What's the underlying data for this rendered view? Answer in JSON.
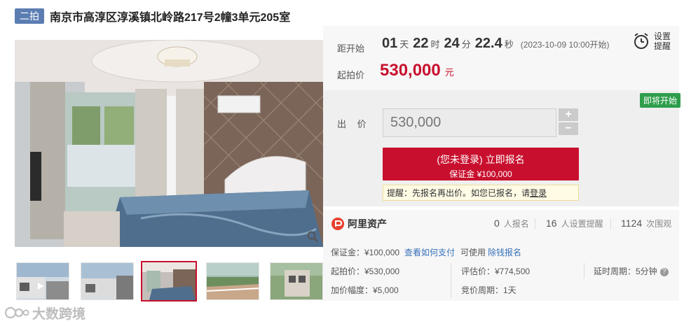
{
  "header": {
    "round_badge": "二拍",
    "title": "南京市高淳区淳溪镇北岭路217号2幢3单元205室"
  },
  "gallery": {
    "thumbnail_count": 5,
    "active_thumbnail": 3
  },
  "watermark": {
    "text": "大数跨境"
  },
  "countdown": {
    "label": "距开始",
    "days": "01",
    "days_unit": "天",
    "hours": "22",
    "hours_unit": "时",
    "minutes": "24",
    "minutes_unit": "分",
    "seconds": "22.4",
    "seconds_unit": "秒",
    "start_time": "(2023-10-09 10:00开始)"
  },
  "start_price": {
    "label": "起拍价",
    "value": "530,000",
    "unit": "元"
  },
  "reminder": {
    "label": "设置提醒",
    "icon": "alarm-clock-icon"
  },
  "bid": {
    "status_tag": "即将开始",
    "label": "出 价",
    "value": "530,000",
    "plus": "+",
    "minus": "−",
    "register_line1": "(您未登录) 立即报名",
    "register_line2": "保证金 ¥100,000",
    "tip_text": "提醒：先报名再出价。如您已报名，请",
    "tip_link": "登录"
  },
  "stats": {
    "brand": "阿里资产",
    "registered_count": "0",
    "registered_label": "人报名",
    "reminder_count": "16",
    "reminder_label": "人设置提醒",
    "view_count": "1124",
    "view_label": "次围观"
  },
  "details": {
    "deposit": "保证金：¥100,000",
    "how_to_pay": "查看如何支付",
    "can_use": "可使用",
    "credit_register": "除钱报名",
    "start_price": "起拍价：¥530,000",
    "appraisal": "评估价：¥774,500",
    "delay_period": "延时周期：5分钟",
    "increment": "加价幅度：¥5,000",
    "bid_period": "竞价周期：1天"
  },
  "colors": {
    "accent_red": "#c8102e",
    "badge_blue": "#5b7db2",
    "status_green": "#2f9e4c",
    "link_blue": "#3771b9"
  }
}
